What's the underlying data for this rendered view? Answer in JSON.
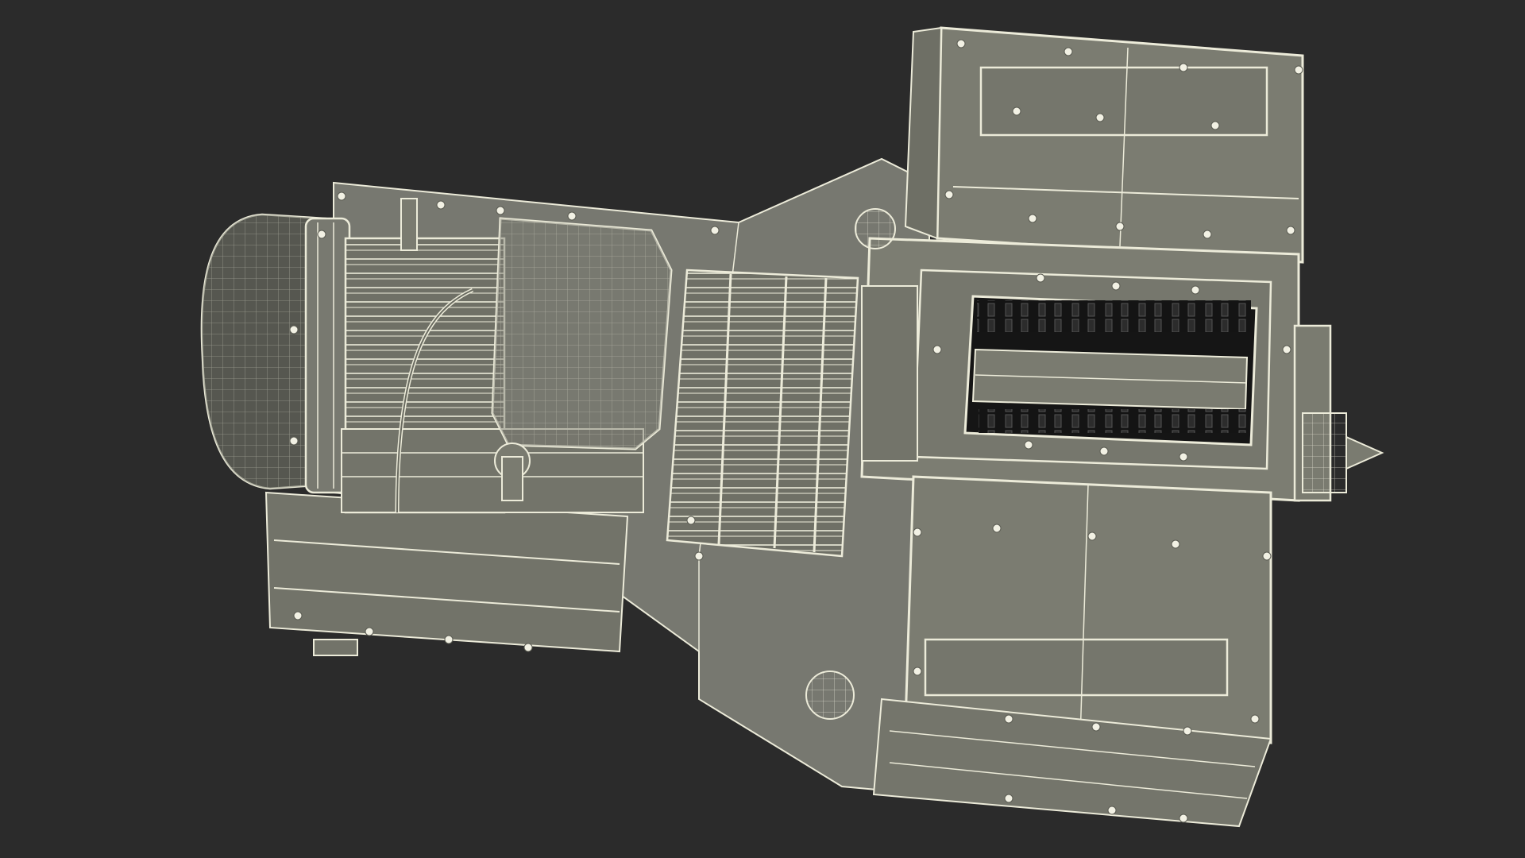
{
  "scene": {
    "background_color": "#2b2b2b",
    "model_fill": "#7a7b70",
    "model_fill_dark": "#6a6b61",
    "wire_color": "#ecebd9",
    "bolt_color": "#f2f1e4",
    "cavity_color": "#151515",
    "subject": "hammer-mill-wireframe-render"
  }
}
